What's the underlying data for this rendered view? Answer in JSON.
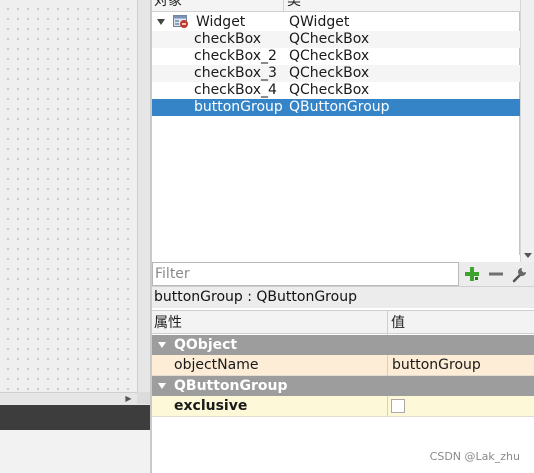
{
  "inspector": {
    "col_object": "对象",
    "col_class": "类",
    "tree": [
      {
        "name": "Widget",
        "class": "QWidget"
      },
      {
        "name": "checkBox",
        "class": "QCheckBox"
      },
      {
        "name": "checkBox_2",
        "class": "QCheckBox"
      },
      {
        "name": "checkBox_3",
        "class": "QCheckBox"
      },
      {
        "name": "checkBox_4",
        "class": "QCheckBox"
      },
      {
        "name": "buttonGroup",
        "class": "QButtonGroup"
      }
    ]
  },
  "property_editor": {
    "filter_placeholder": "Filter",
    "object_label": "buttonGroup : QButtonGroup",
    "col_property": "属性",
    "col_value": "值",
    "groups": [
      {
        "label": "QObject",
        "props": [
          {
            "name": "objectName",
            "value": "buttonGroup"
          }
        ]
      },
      {
        "label": "QButtonGroup",
        "props": [
          {
            "name": "exclusive",
            "checked": false
          }
        ]
      }
    ]
  },
  "watermark": "CSDN @Lak_zhu",
  "colors": {
    "selection": "#3584c7",
    "group_header": "#9d9d9d",
    "row_peach": "#fdecd6",
    "row_cream": "#fdf8d7",
    "add_icon": "#3ea22f"
  },
  "icons": [
    "widget-icon",
    "expand-arrow-icon",
    "plus-icon",
    "minus-icon",
    "wrench-icon",
    "scroll-down-icon",
    "scroll-right-icon"
  ]
}
